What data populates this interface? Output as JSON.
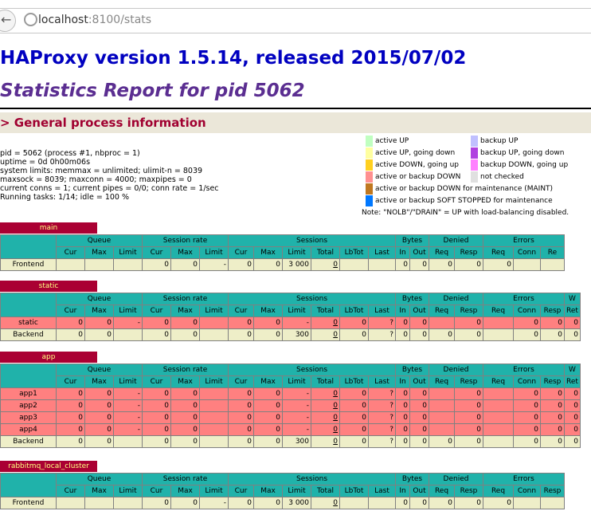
{
  "browser": {
    "url_host": "localhost",
    "url_rest": ":8100/stats"
  },
  "header": {
    "title": "HAProxy version 1.5.14, released 2015/07/02",
    "subtitle": "Statistics Report for pid 5062",
    "section": "> General process information"
  },
  "process_info": [
    "pid = 5062 (process #1, nbproc = 1)",
    "uptime = 0d 0h00m06s",
    "system limits: memmax = unlimited; ulimit-n = 8039",
    "maxsock = 8039; maxconn = 4000; maxpipes = 0",
    "current conns = 1; current pipes = 0/0; conn rate = 1/sec",
    "Running tasks: 1/14; idle = 100 %"
  ],
  "legend": {
    "left": [
      {
        "label": "active UP",
        "color": "#c0ffc0"
      },
      {
        "label": "active UP, going down",
        "color": "#ffffa0"
      },
      {
        "label": "active DOWN, going up",
        "color": "#ffd020"
      },
      {
        "label": "active or backup DOWN",
        "color": "#ff9090"
      },
      {
        "label": "active or backup DOWN for maintenance (MAINT)",
        "color": "#c07820"
      },
      {
        "label": "active or backup SOFT STOPPED for maintenance",
        "color": "#0078ff"
      }
    ],
    "right": [
      {
        "label": "backup UP",
        "color": "#c0c0ff"
      },
      {
        "label": "backup UP, going down",
        "color": "#b040e0"
      },
      {
        "label": "backup DOWN, going up",
        "color": "#ff80ff"
      },
      {
        "label": "not checked",
        "color": "#e0e0e0"
      }
    ],
    "note": "Note: \"NOLB\"/\"DRAIN\" = UP with load-balancing disabled."
  },
  "tables": {
    "main": {
      "title": "main",
      "groups": [
        "Queue",
        "Session rate",
        "Sessions",
        "Bytes",
        "Denied",
        "Errors"
      ],
      "cols": [
        "Cur",
        "Max",
        "Limit",
        "Cur",
        "Max",
        "Limit",
        "Cur",
        "Max",
        "Limit",
        "Total",
        "LbTot",
        "Last",
        "In",
        "Out",
        "Req",
        "Resp",
        "Req",
        "Conn",
        "Re"
      ],
      "rows": [
        {
          "name": "Frontend",
          "cells": [
            "",
            "",
            "",
            "0",
            "0",
            "-",
            "0",
            "0",
            "3 000",
            "0",
            "",
            "",
            "0",
            "0",
            "0",
            "0",
            "0",
            "",
            ""
          ]
        }
      ]
    },
    "static": {
      "title": "static",
      "groups": [
        "Queue",
        "Session rate",
        "Sessions",
        "Bytes",
        "Denied",
        "Errors",
        "W"
      ],
      "cols": [
        "Cur",
        "Max",
        "Limit",
        "Cur",
        "Max",
        "Limit",
        "Cur",
        "Max",
        "Limit",
        "Total",
        "LbTot",
        "Last",
        "In",
        "Out",
        "Req",
        "Resp",
        "Req",
        "Conn",
        "Resp",
        "Ret"
      ],
      "rows": [
        {
          "name": "static",
          "cells": [
            "0",
            "0",
            "-",
            "0",
            "0",
            "",
            "0",
            "0",
            "-",
            "0",
            "0",
            "?",
            "0",
            "0",
            "",
            "0",
            "",
            "0",
            "0",
            "0"
          ]
        },
        {
          "name": "Backend",
          "cells": [
            "0",
            "0",
            "",
            "0",
            "0",
            "",
            "0",
            "0",
            "300",
            "0",
            "0",
            "?",
            "0",
            "0",
            "0",
            "0",
            "",
            "0",
            "0",
            "0"
          ]
        }
      ]
    },
    "app": {
      "title": "app",
      "groups": [
        "Queue",
        "Session rate",
        "Sessions",
        "Bytes",
        "Denied",
        "Errors",
        "W"
      ],
      "cols": [
        "Cur",
        "Max",
        "Limit",
        "Cur",
        "Max",
        "Limit",
        "Cur",
        "Max",
        "Limit",
        "Total",
        "LbTot",
        "Last",
        "In",
        "Out",
        "Req",
        "Resp",
        "Req",
        "Conn",
        "Resp",
        "Ret"
      ],
      "rows": [
        {
          "name": "app1",
          "cells": [
            "0",
            "0",
            "-",
            "0",
            "0",
            "",
            "0",
            "0",
            "-",
            "0",
            "0",
            "?",
            "0",
            "0",
            "",
            "0",
            "",
            "0",
            "0",
            "0"
          ]
        },
        {
          "name": "app2",
          "cells": [
            "0",
            "0",
            "-",
            "0",
            "0",
            "",
            "0",
            "0",
            "-",
            "0",
            "0",
            "?",
            "0",
            "0",
            "",
            "0",
            "",
            "0",
            "0",
            "0"
          ]
        },
        {
          "name": "app3",
          "cells": [
            "0",
            "0",
            "-",
            "0",
            "0",
            "",
            "0",
            "0",
            "-",
            "0",
            "0",
            "?",
            "0",
            "0",
            "",
            "0",
            "",
            "0",
            "0",
            "0"
          ]
        },
        {
          "name": "app4",
          "cells": [
            "0",
            "0",
            "-",
            "0",
            "0",
            "",
            "0",
            "0",
            "-",
            "0",
            "0",
            "?",
            "0",
            "0",
            "",
            "0",
            "",
            "0",
            "0",
            "0"
          ]
        },
        {
          "name": "Backend",
          "cells": [
            "0",
            "0",
            "",
            "0",
            "0",
            "",
            "0",
            "0",
            "300",
            "0",
            "0",
            "?",
            "0",
            "0",
            "0",
            "0",
            "",
            "0",
            "0",
            "0"
          ]
        }
      ]
    },
    "rabbit": {
      "title": "rabbitmq_local_cluster",
      "groups": [
        "Queue",
        "Session rate",
        "Sessions",
        "Bytes",
        "Denied",
        "Errors"
      ],
      "cols": [
        "Cur",
        "Max",
        "Limit",
        "Cur",
        "Max",
        "Limit",
        "Cur",
        "Max",
        "Limit",
        "Total",
        "LbTot",
        "Last",
        "In",
        "Out",
        "Req",
        "Resp",
        "Req",
        "Conn",
        "Resp"
      ],
      "rows": [
        {
          "name": "Frontend",
          "cells": [
            "",
            "",
            "",
            "0",
            "0",
            "-",
            "0",
            "0",
            "3 000",
            "0",
            "",
            "",
            "0",
            "0",
            "0",
            "0",
            "0",
            "",
            ""
          ]
        }
      ]
    }
  }
}
